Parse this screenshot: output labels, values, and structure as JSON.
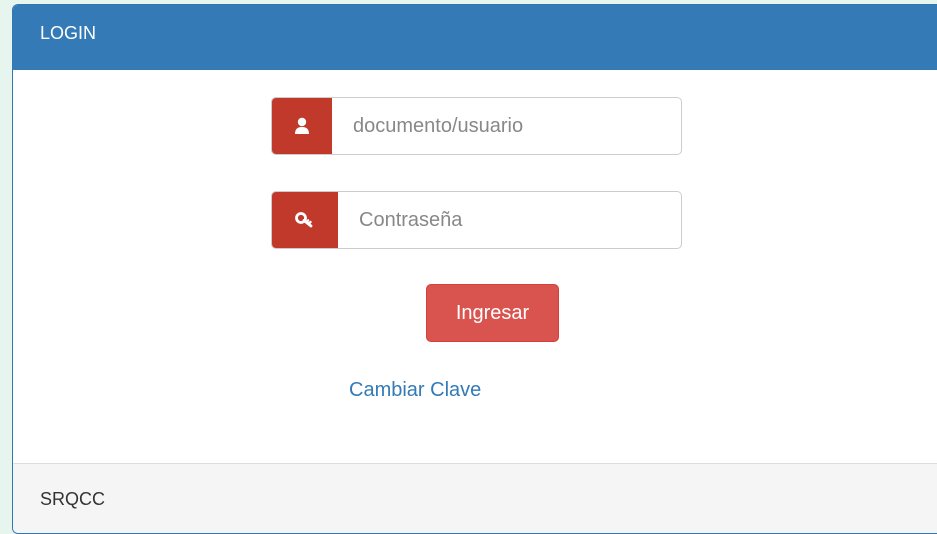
{
  "panel": {
    "heading": "LOGIN",
    "footer": "SRQCC"
  },
  "form": {
    "user": {
      "icon": "user-icon",
      "placeholder": "documento/usuario",
      "value": ""
    },
    "password": {
      "icon": "key-icon",
      "placeholder": "Contraseña",
      "value": ""
    },
    "submit_label": "Ingresar",
    "change_password_link": "Cambiar Clave"
  },
  "colors": {
    "background": "#e6f6ef",
    "heading": "#337ab7",
    "addon": "#c0392b",
    "button": "#d9534f",
    "link": "#337ab7",
    "footer": "#f5f5f5"
  }
}
